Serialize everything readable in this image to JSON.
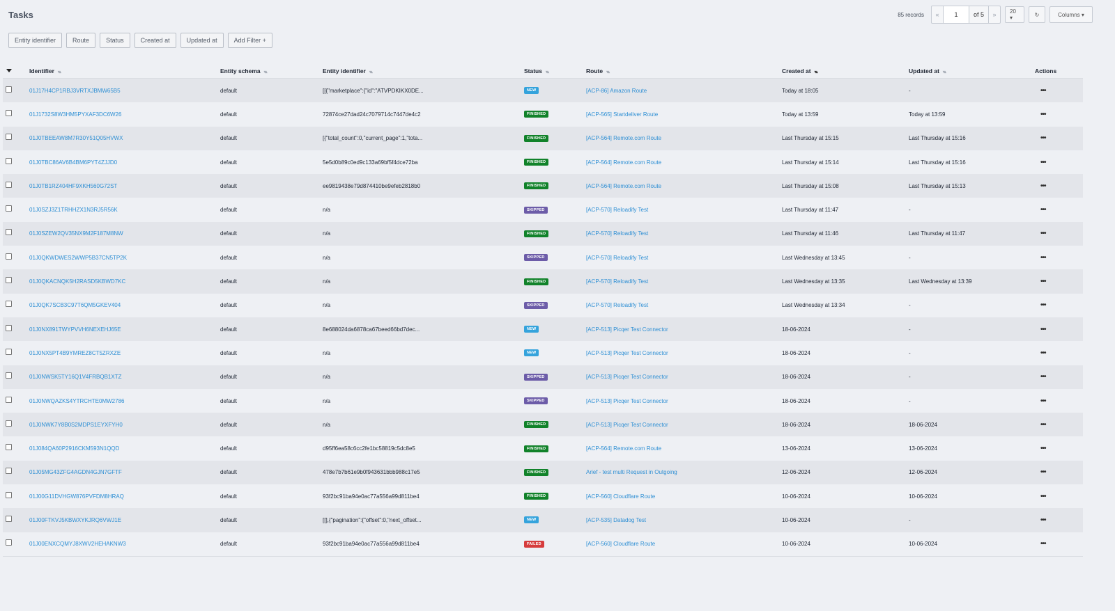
{
  "page": {
    "title": "Tasks"
  },
  "toolbar": {
    "records": "85 records",
    "page_value": "1",
    "page_of": "of 5",
    "prev_icon": "«",
    "next_icon": "»",
    "page_size": "20 ▾",
    "refresh_icon": "↻",
    "columns_label": "Columns ▾"
  },
  "filters": [
    {
      "label": "Entity identifier"
    },
    {
      "label": "Route"
    },
    {
      "label": "Status"
    },
    {
      "label": "Created at"
    },
    {
      "label": "Updated at"
    },
    {
      "label": "Add Filter +"
    }
  ],
  "columns": {
    "identifier": "Identifier",
    "entity_schema": "Entity schema",
    "entity_identifier": "Entity identifier",
    "status": "Status",
    "route": "Route",
    "created_at": "Created at",
    "updated_at": "Updated at",
    "actions": "Actions"
  },
  "status_colors": {
    "NEW": "#35a3dc",
    "FINISHED": "#11822a",
    "SKIPPED": "#6c5ca8",
    "FAILED": "#d63c3c"
  },
  "rows": [
    {
      "id": "01J17H4CP1RBJ3VRTXJBMW65B5",
      "schema": "default",
      "entity": "[[{\"marketplace\":{\"id\":\"ATVPDKIKX0DE...",
      "status": "NEW",
      "route": "[ACP-86] Amazon Route",
      "created": "Today at 18:05",
      "updated": "-"
    },
    {
      "id": "01J1732S8W3HM5PYXAF3DC6W26",
      "schema": "default",
      "entity": "72874ce27dad24c7079714c7447de4c2",
      "status": "FINISHED",
      "route": "[ACP-565] Startdeliver Route",
      "created": "Today at 13:59",
      "updated": "Today at 13:59"
    },
    {
      "id": "01J0TBEEAW8M7R30Y51Q05HVWX",
      "schema": "default",
      "entity": "[{\"total_count\":0,\"current_page\":1,\"tota...",
      "status": "FINISHED",
      "route": "[ACP-564] Remote.com Route",
      "created": "Last Thursday at 15:15",
      "updated": "Last Thursday at 15:16"
    },
    {
      "id": "01J0TBC86AV6B4BM6PYT4ZJJD0",
      "schema": "default",
      "entity": "5e5d0b89c0ed9c133a69bf5f4dce72ba",
      "status": "FINISHED",
      "route": "[ACP-564] Remote.com Route",
      "created": "Last Thursday at 15:14",
      "updated": "Last Thursday at 15:16"
    },
    {
      "id": "01J0TB1RZ404HF9XKH560G72ST",
      "schema": "default",
      "entity": "ee9819438e79d874410be9efeb2818b0",
      "status": "FINISHED",
      "route": "[ACP-564] Remote.com Route",
      "created": "Last Thursday at 15:08",
      "updated": "Last Thursday at 15:13"
    },
    {
      "id": "01J0SZJ3Z1TRHHZX1N3RJ5R56K",
      "schema": "default",
      "entity": "n/a",
      "status": "SKIPPED",
      "route": "[ACP-570] Reloadify Test",
      "created": "Last Thursday at 11:47",
      "updated": "-"
    },
    {
      "id": "01J0SZEW2QV35NX9M2F187M8NW",
      "schema": "default",
      "entity": "n/a",
      "status": "FINISHED",
      "route": "[ACP-570] Reloadify Test",
      "created": "Last Thursday at 11:46",
      "updated": "Last Thursday at 11:47"
    },
    {
      "id": "01J0QKWDWES2WWP5B37CN5TP2K",
      "schema": "default",
      "entity": "n/a",
      "status": "SKIPPED",
      "route": "[ACP-570] Reloadify Test",
      "created": "Last Wednesday at 13:45",
      "updated": "-"
    },
    {
      "id": "01J0QKACNQK5H2RASD5KBWD7KC",
      "schema": "default",
      "entity": "n/a",
      "status": "FINISHED",
      "route": "[ACP-570] Reloadify Test",
      "created": "Last Wednesday at 13:35",
      "updated": "Last Wednesday at 13:39"
    },
    {
      "id": "01J0QK7SCB3C97T6QM5GKEV404",
      "schema": "default",
      "entity": "n/a",
      "status": "SKIPPED",
      "route": "[ACP-570] Reloadify Test",
      "created": "Last Wednesday at 13:34",
      "updated": "-"
    },
    {
      "id": "01J0NX891TWYPVVH6NEXEHJ65E",
      "schema": "default",
      "entity": "8e688024da6878ca67beed66bd7dec...",
      "status": "NEW",
      "route": "[ACP-513] Picqer Test Connector",
      "created": "18-06-2024",
      "updated": "-"
    },
    {
      "id": "01J0NX5PT4B9YMREZ8CT5ZRXZE",
      "schema": "default",
      "entity": "n/a",
      "status": "NEW",
      "route": "[ACP-513] Picqer Test Connector",
      "created": "18-06-2024",
      "updated": "-"
    },
    {
      "id": "01J0NWSK5TY16Q1V4FRBQB1XTZ",
      "schema": "default",
      "entity": "n/a",
      "status": "SKIPPED",
      "route": "[ACP-513] Picqer Test Connector",
      "created": "18-06-2024",
      "updated": "-"
    },
    {
      "id": "01J0NWQAZKS4YTRCHTE0MW2786",
      "schema": "default",
      "entity": "n/a",
      "status": "SKIPPED",
      "route": "[ACP-513] Picqer Test Connector",
      "created": "18-06-2024",
      "updated": "-"
    },
    {
      "id": "01J0NWK7Y8B0S2MDPS1EYXFYH0",
      "schema": "default",
      "entity": "n/a",
      "status": "FINISHED",
      "route": "[ACP-513] Picqer Test Connector",
      "created": "18-06-2024",
      "updated": "18-06-2024"
    },
    {
      "id": "01J084QA60P2916CKM593N1QQD",
      "schema": "default",
      "entity": "d95ff6ea58c6cc2fe1bc58819c5dc8e5",
      "status": "FINISHED",
      "route": "[ACP-564] Remote.com Route",
      "created": "13-06-2024",
      "updated": "13-06-2024"
    },
    {
      "id": "01J05MG43ZFG4AGDN4GJN7GFTF",
      "schema": "default",
      "entity": "478e7b7b61e9b0f943631bbb988c17e5",
      "status": "FINISHED",
      "route": "Arief - test multi Request in Outgoing",
      "created": "12-06-2024",
      "updated": "12-06-2024"
    },
    {
      "id": "01J00G11DVHGW876PVFDM8HRAQ",
      "schema": "default",
      "entity": "93f2bc91ba94e0ac77a556a99d811be4",
      "status": "FINISHED",
      "route": "[ACP-560] Cloudflare Route",
      "created": "10-06-2024",
      "updated": "10-06-2024"
    },
    {
      "id": "01J00FTKVJ5KBWXYKJRQ6VWJ1E",
      "schema": "default",
      "entity": "[[],{\"pagination\":{\"offset\":0,\"next_offset...",
      "status": "NEW",
      "route": "[ACP-535] Datadog Test",
      "created": "10-06-2024",
      "updated": "-"
    },
    {
      "id": "01J00ENXCQMYJ8XWV2HEHAKNW3",
      "schema": "default",
      "entity": "93f2bc91ba94e0ac77a556a99d811be4",
      "status": "FAILED",
      "route": "[ACP-560] Cloudflare Route",
      "created": "10-06-2024",
      "updated": "10-06-2024"
    }
  ]
}
